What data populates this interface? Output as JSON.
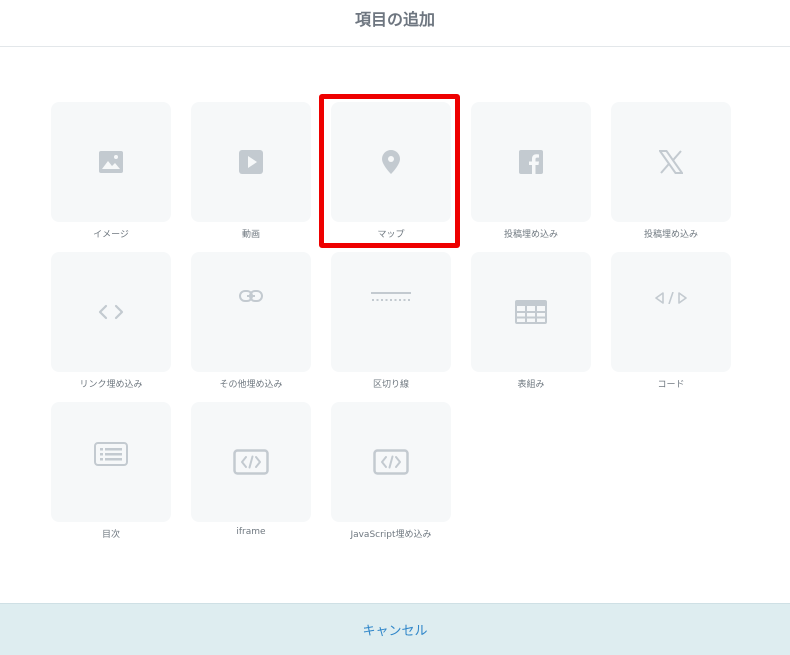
{
  "header": {
    "title": "項目の追加"
  },
  "items": [
    {
      "label": "イメージ",
      "icon": "image-icon"
    },
    {
      "label": "動画",
      "icon": "video-play-icon"
    },
    {
      "label": "マップ",
      "icon": "map-pin-icon"
    },
    {
      "label": "投稿埋め込み",
      "icon": "facebook-icon"
    },
    {
      "label": "投稿埋め込み",
      "icon": "x-logo-icon"
    },
    {
      "label": "リンク埋め込み",
      "icon": "code-brackets-icon"
    },
    {
      "label": "その他埋め込み",
      "icon": "link-icon"
    },
    {
      "label": "区切り線",
      "icon": "divider-icon"
    },
    {
      "label": "表組み",
      "icon": "table-icon"
    },
    {
      "label": "コード",
      "icon": "code-icon"
    },
    {
      "label": "目次",
      "icon": "toc-list-icon"
    },
    {
      "label": "iframe",
      "icon": "embed-code-icon"
    },
    {
      "label": "JavaScript埋め込み",
      "icon": "embed-code-icon"
    }
  ],
  "footer": {
    "cancel_label": "キャンセル"
  },
  "colors": {
    "icon": "#c3cad0",
    "tile_bg": "#f6f8f9",
    "highlight": "#ee0000",
    "cancel_text": "#2f86c9",
    "footer_bg": "#deedf0"
  }
}
